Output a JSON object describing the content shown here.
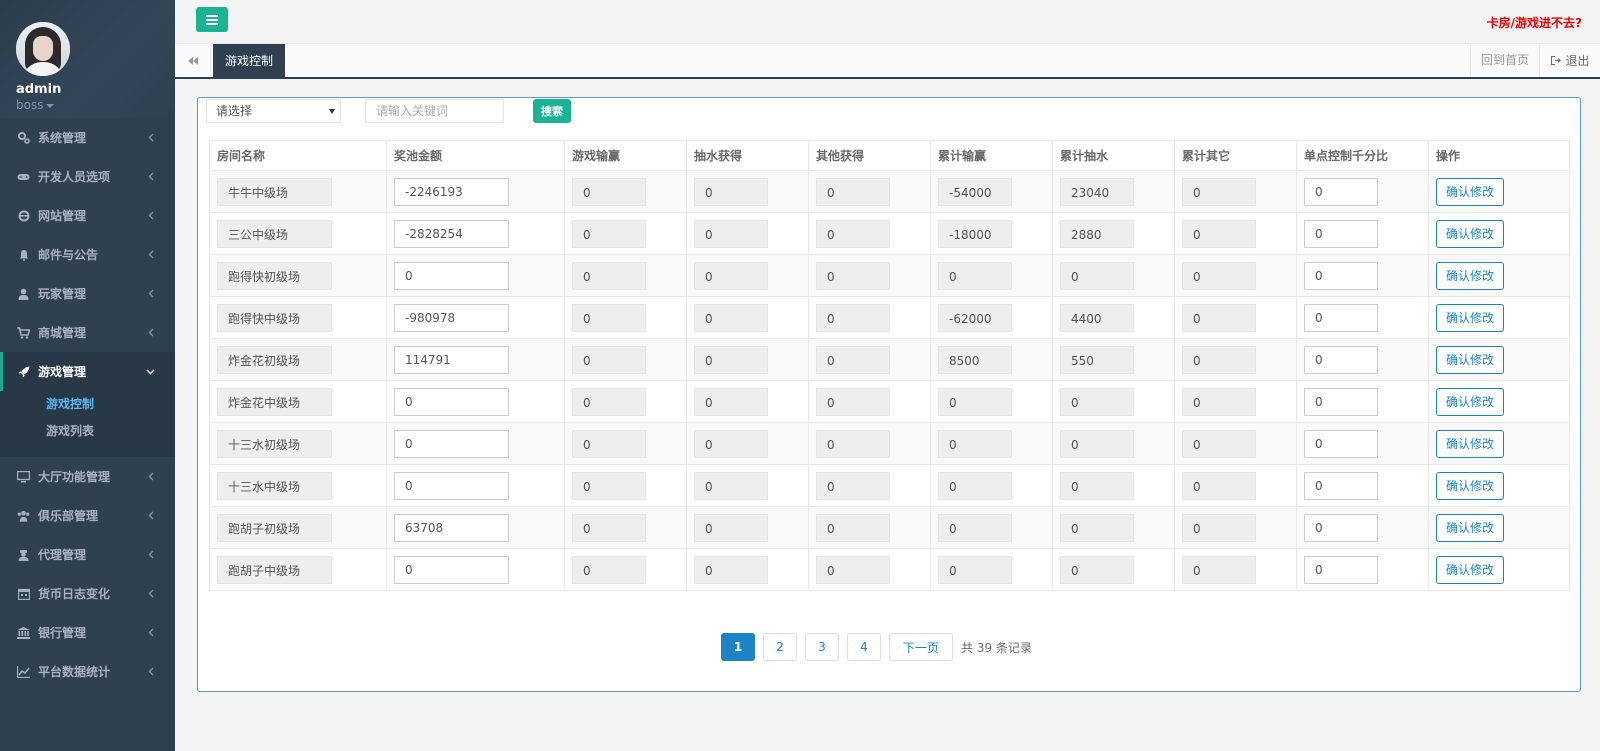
{
  "sidebar": {
    "username": "admin",
    "role": "boss",
    "items": [
      {
        "label": "系统管理",
        "icon": "gears-icon"
      },
      {
        "label": "开发人员选项",
        "icon": "gamepad-icon"
      },
      {
        "label": "网站管理",
        "icon": "ie-icon"
      },
      {
        "label": "邮件与公告",
        "icon": "bell-icon"
      },
      {
        "label": "玩家管理",
        "icon": "user-icon"
      },
      {
        "label": "商城管理",
        "icon": "cart-icon"
      },
      {
        "label": "游戏管理",
        "icon": "rocket-icon"
      },
      {
        "label": "大厅功能管理",
        "icon": "desktop-icon"
      },
      {
        "label": "俱乐部管理",
        "icon": "users-icon"
      },
      {
        "label": "代理管理",
        "icon": "user-secret-icon"
      },
      {
        "label": "货币日志变化",
        "icon": "calendar-icon"
      },
      {
        "label": "银行管理",
        "icon": "bank-icon"
      },
      {
        "label": "平台数据统计",
        "icon": "line-chart-icon"
      }
    ],
    "subitems": [
      {
        "label": "游戏控制"
      },
      {
        "label": "游戏列表"
      }
    ]
  },
  "topbar": {
    "help_link": "卡房/游戏进不去?"
  },
  "tabs": {
    "active": "游戏控制",
    "home": "回到首页",
    "logout": "退出"
  },
  "filters": {
    "select_value": "请选择",
    "keyword_placeholder": "请输入关键词",
    "search_label": "搜索"
  },
  "table": {
    "headers": [
      "房间名称",
      "奖池金额",
      "游戏输赢",
      "抽水获得",
      "其他获得",
      "累计输赢",
      "累计抽水",
      "累计其它",
      "单点控制千分比",
      "操作"
    ],
    "action_label": "确认修改",
    "rows": [
      [
        "牛牛中级场",
        "-2246193",
        "0",
        "0",
        "0",
        "-54000",
        "23040",
        "0",
        "0"
      ],
      [
        "三公中级场",
        "-2828254",
        "0",
        "0",
        "0",
        "-18000",
        "2880",
        "0",
        "0"
      ],
      [
        "跑得快初级场",
        "0",
        "0",
        "0",
        "0",
        "0",
        "0",
        "0",
        "0"
      ],
      [
        "跑得快中级场",
        "-980978",
        "0",
        "0",
        "0",
        "-62000",
        "4400",
        "0",
        "0"
      ],
      [
        "炸金花初级场",
        "114791",
        "0",
        "0",
        "0",
        "8500",
        "550",
        "0",
        "0"
      ],
      [
        "炸金花中级场",
        "0",
        "0",
        "0",
        "0",
        "0",
        "0",
        "0",
        "0"
      ],
      [
        "十三水初级场",
        "0",
        "0",
        "0",
        "0",
        "0",
        "0",
        "0",
        "0"
      ],
      [
        "十三水中级场",
        "0",
        "0",
        "0",
        "0",
        "0",
        "0",
        "0",
        "0"
      ],
      [
        "跑胡子初级场",
        "63708",
        "0",
        "0",
        "0",
        "0",
        "0",
        "0",
        "0"
      ],
      [
        "跑胡子中级场",
        "0",
        "0",
        "0",
        "0",
        "0",
        "0",
        "0",
        "0"
      ]
    ]
  },
  "pagination": {
    "pages": [
      "1",
      "2",
      "3",
      "4"
    ],
    "current": "1",
    "next_label": "下一页",
    "total_text": "共 39 条记录"
  }
}
